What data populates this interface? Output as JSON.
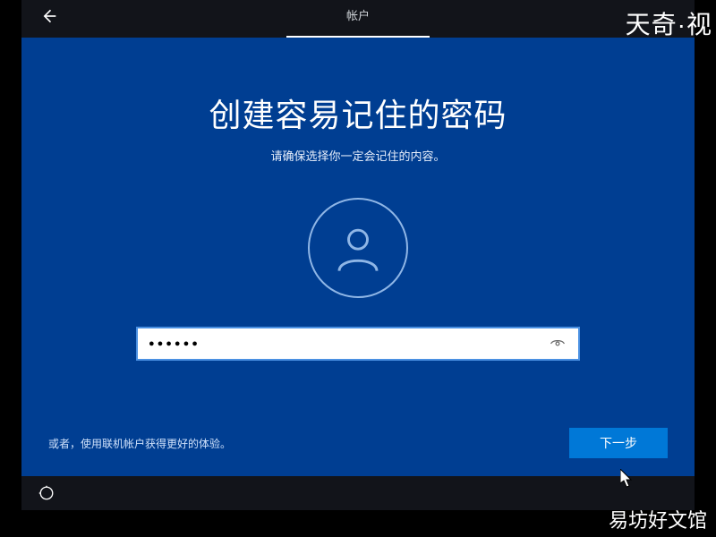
{
  "header": {
    "tab_label": "帐户"
  },
  "main": {
    "title": "创建容易记住的密码",
    "subtitle": "请确保选择你一定会记住的内容。",
    "password_value": "●●●●●●",
    "alt_account_text": "或者，使用联机帐户获得更好的体验。",
    "next_button": "下一步"
  },
  "watermarks": {
    "top_right": "天奇·视",
    "bottom_right": "易坊好文馆"
  },
  "colors": {
    "background": "#003e92",
    "bar": "#12141a",
    "primary_button": "#0078d7"
  }
}
